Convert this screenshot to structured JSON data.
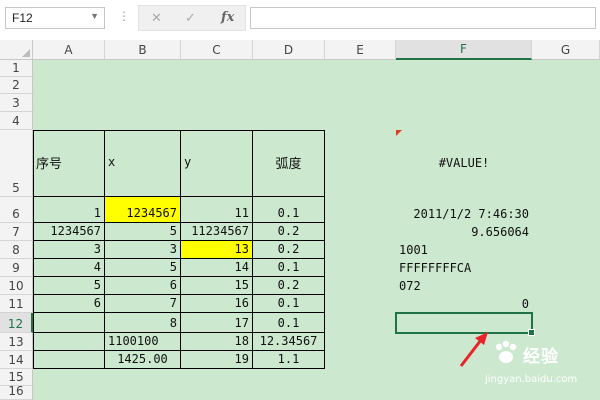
{
  "name_box": {
    "value": "F12"
  },
  "formula_bar": {
    "fx_label": "fx",
    "cancel_glyph": "✕",
    "enter_glyph": "✓",
    "content": ""
  },
  "columns": [
    "A",
    "B",
    "C",
    "D",
    "E",
    "F",
    "G"
  ],
  "selected_column": "F",
  "rows": [
    "1",
    "2",
    "3",
    "4",
    "5",
    "6",
    "7",
    "8",
    "9",
    "10",
    "11",
    "12",
    "13",
    "14",
    "15",
    "16"
  ],
  "selected_row": "12",
  "table": {
    "headers": {
      "a": "序号",
      "b": "x",
      "c": "y",
      "d": "弧度"
    },
    "rows": [
      {
        "a": "1",
        "b": "1234567",
        "c": "11",
        "d": "0.1"
      },
      {
        "a": "1234567",
        "b": "5",
        "c": "11234567",
        "d": "0.2"
      },
      {
        "a": "3",
        "b": "3",
        "c": "13",
        "d": "0.2"
      },
      {
        "a": "4",
        "b": "5",
        "c": "14",
        "d": "0.1"
      },
      {
        "a": "5",
        "b": "6",
        "c": "15",
        "d": "0.2"
      },
      {
        "a": "6",
        "b": "7",
        "c": "16",
        "d": "0.1"
      },
      {
        "a": "",
        "b": "8",
        "c": "17",
        "d": "0.1"
      },
      {
        "a": "",
        "b": "1100100",
        "c": "18",
        "d": "12.34567"
      },
      {
        "a": "",
        "b": "1425.00",
        "c": "19",
        "d": "1.1"
      }
    ]
  },
  "col_f": {
    "r5": "#VALUE!",
    "r6": "2011/1/2 7:46:30",
    "r7": "9.656064",
    "r8": "1001",
    "r9": "FFFFFFFFCA",
    "r10": "072",
    "r11": "0"
  },
  "highlight_color": "#ffff00",
  "selection_color": "#217346",
  "watermark": {
    "main": "经验",
    "sub": "jingyan.baidu.com"
  }
}
